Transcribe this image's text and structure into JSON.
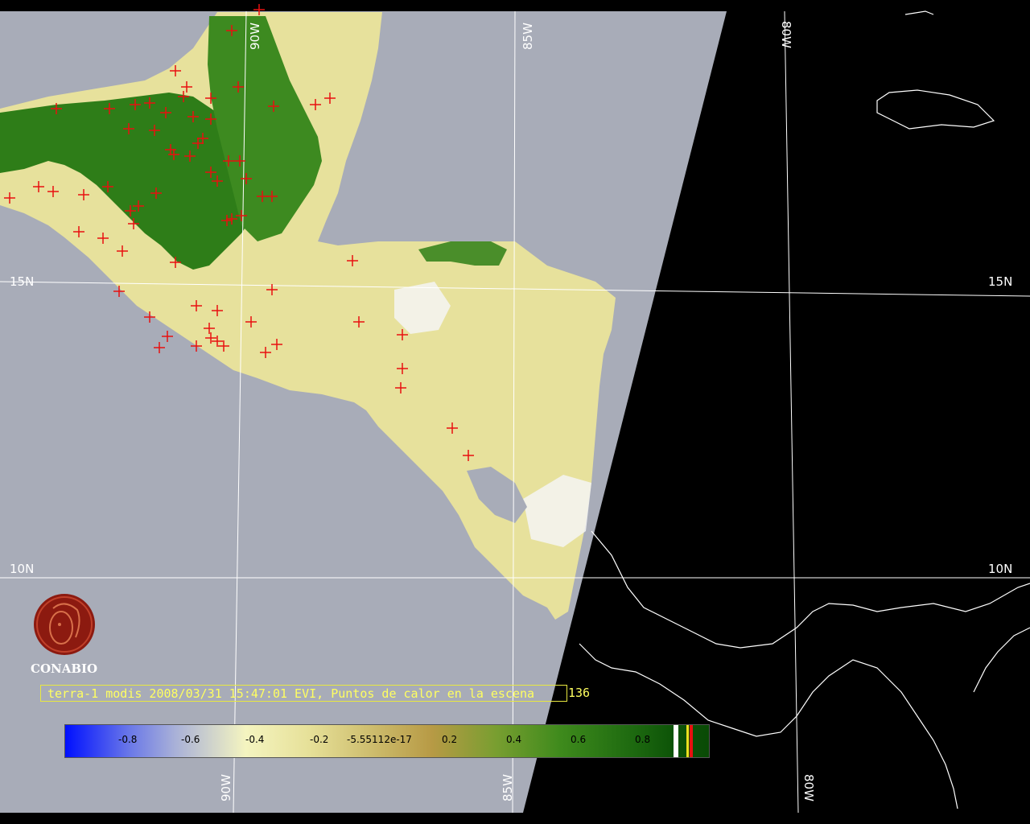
{
  "map": {
    "grid_labels": {
      "lon_90w_top": "90W",
      "lon_85w_top": "85W",
      "lon_80w_top": "80W",
      "lon_90w_bottom": "90W",
      "lon_85w_bottom": "85W",
      "lon_80w_bottom": "80W",
      "lat_15n_left": "15N",
      "lat_15n_right": "15N",
      "lat_10n_left": "10N",
      "lat_10n_right": "10N"
    },
    "colors": {
      "ocean_day": "#a8acb8",
      "night": "#000000",
      "grid": "#ffffff",
      "hotspot": "#e81010",
      "land_green": "#2e7d18",
      "land_yellow": "#e9e4a0"
    }
  },
  "logo": {
    "name": "CONABIO"
  },
  "caption": {
    "text": "terra-1 modis 2008/03/31 15:47:01 EVI, Puntos de calor en la escena",
    "overflow": "136"
  },
  "colorbar": {
    "ticks": [
      "-0.8",
      "-0.6",
      "-0.4",
      "-0.2",
      "-5.55112e-17",
      "0.2",
      "0.4",
      "0.6",
      "0.8"
    ],
    "range": [
      -1,
      1
    ]
  }
}
